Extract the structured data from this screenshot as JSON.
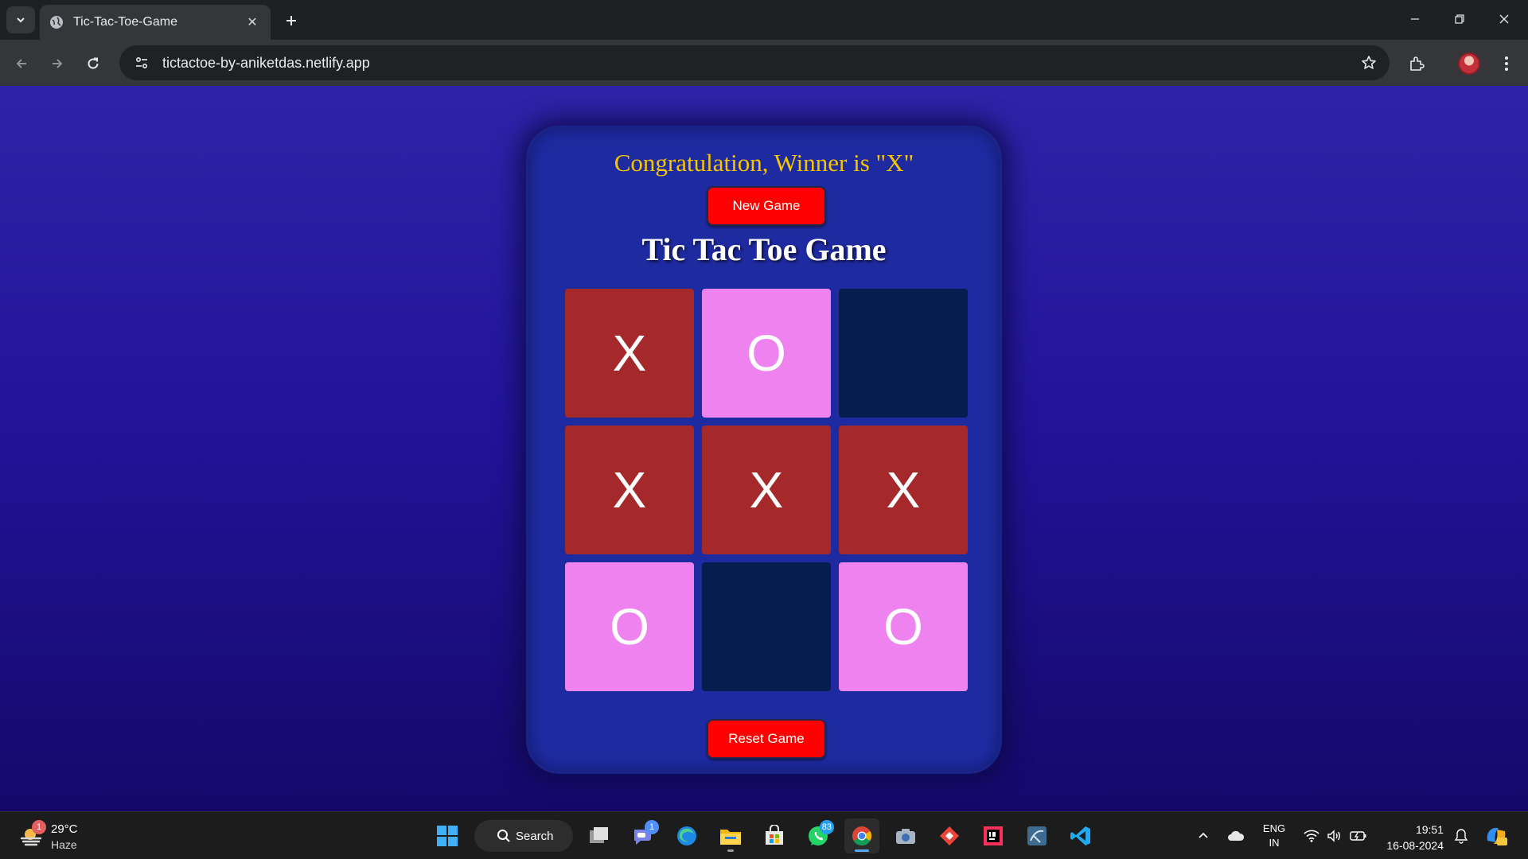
{
  "browser": {
    "tab_title": "Tic-Tac-Toe-Game",
    "url": "tictactoe-by-aniketdas.netlify.app"
  },
  "page": {
    "winner_message": "Congratulation, Winner is \"X\"",
    "new_game_label": "New Game",
    "title": "Tic Tac Toe Game",
    "reset_label": "Reset Game",
    "board": [
      [
        "X",
        "O",
        ""
      ],
      [
        "X",
        "X",
        "X"
      ],
      [
        "O",
        "",
        "O"
      ]
    ],
    "colors": {
      "x_cell": "#a5292a",
      "o_cell": "#ee82ee",
      "empty_cell": "#061d4f",
      "button": "#ff0000",
      "message": "#f7c500"
    }
  },
  "taskbar": {
    "weather": {
      "alert_count": "1",
      "temp": "29°C",
      "condition": "Haze"
    },
    "search_label": "Search",
    "teams_badge": "1",
    "whatsapp_badge": "83",
    "lang_top": "ENG",
    "lang_bottom": "IN",
    "time": "19:51",
    "date": "16-08-2024"
  }
}
